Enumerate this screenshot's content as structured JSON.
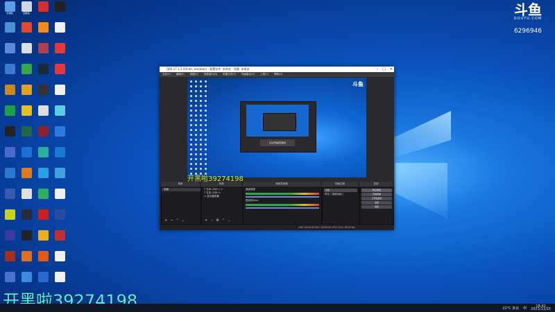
{
  "overlay_text": "开黑啦39274198",
  "preview_overlay_text": "开黑啦39274198",
  "logo": {
    "mark": "斗鱼",
    "sub": "DOUYU.COM",
    "room_number": "6296946"
  },
  "desktop_icons": [
    {
      "label": "此电脑",
      "color": "#5aa0e8"
    },
    {
      "label": "回收站",
      "color": "#cfd7e0"
    },
    {
      "label": "",
      "color": "#d23030"
    },
    {
      "label": "",
      "color": "#222"
    },
    {
      "label": "",
      "color": "#4a90d9"
    },
    {
      "label": "",
      "color": "#e04a2a"
    },
    {
      "label": "",
      "color": "#f28a1c"
    },
    {
      "label": "",
      "color": "#f0f0f0"
    },
    {
      "label": "",
      "color": "#5a8bd8"
    },
    {
      "label": "",
      "color": "#ddd"
    },
    {
      "label": "",
      "color": "#b04050"
    },
    {
      "label": "",
      "color": "#e23a3a"
    },
    {
      "label": "",
      "color": "#3a7ad0"
    },
    {
      "label": "",
      "color": "#35a84a"
    },
    {
      "label": "",
      "color": "#1b2838"
    },
    {
      "label": "",
      "color": "#e03a3a"
    },
    {
      "label": "",
      "color": "#c88a20"
    },
    {
      "label": "",
      "color": "#e6a020"
    },
    {
      "label": "",
      "color": "#333"
    },
    {
      "label": "",
      "color": "#f0f0f0"
    },
    {
      "label": "",
      "color": "#1ea04a"
    },
    {
      "label": "",
      "color": "#e8c020"
    },
    {
      "label": "",
      "color": "#ddd"
    },
    {
      "label": "",
      "color": "#5ad0e0"
    },
    {
      "label": "",
      "color": "#222"
    },
    {
      "label": "",
      "color": "#226644"
    },
    {
      "label": "",
      "color": "#8a2030"
    },
    {
      "label": "",
      "color": "#2a7ae0"
    },
    {
      "label": "",
      "color": "#4a6ad0"
    },
    {
      "label": "",
      "color": "#1a6fd8"
    },
    {
      "label": "",
      "color": "#2ab0a0"
    },
    {
      "label": "",
      "color": "#1a7ad0"
    },
    {
      "label": "",
      "color": "#2a7ad0"
    },
    {
      "label": "",
      "color": "#e07a20"
    },
    {
      "label": "",
      "color": "#2aa0e0"
    },
    {
      "label": "",
      "color": "#40a0e0"
    },
    {
      "label": "",
      "color": "#3a5ab0"
    },
    {
      "label": "",
      "color": "#e0e0e0"
    },
    {
      "label": "",
      "color": "#2ab060"
    },
    {
      "label": "",
      "color": "#f0f0f0"
    },
    {
      "label": "",
      "color": "#c8d020"
    },
    {
      "label": "",
      "color": "#2a2a3a"
    },
    {
      "label": "",
      "color": "#cc2020"
    },
    {
      "label": "",
      "color": "#2a4aa0"
    },
    {
      "label": "",
      "color": "#3a3aa0"
    },
    {
      "label": "",
      "color": "#222"
    },
    {
      "label": "",
      "color": "#e8b020"
    },
    {
      "label": "",
      "color": "#c03030"
    },
    {
      "label": "",
      "color": "#a03020"
    },
    {
      "label": "",
      "color": "#e07020"
    },
    {
      "label": "",
      "color": "#e05a1a"
    },
    {
      "label": "",
      "color": "#f0f0f0"
    },
    {
      "label": "",
      "color": "#4a70d0"
    },
    {
      "label": "",
      "color": "#3a8ae0"
    },
    {
      "label": "",
      "color": "#2a6ad0"
    },
    {
      "label": "",
      "color": "#f0f0f0"
    }
  ],
  "obs": {
    "title": "OBS 27.1.3 (64-bit, windows) - 配置文件: 未命名 - 场景: 未命名",
    "menu": [
      "文件(F)",
      "编辑(E)",
      "视图(V)",
      "停靠窗口(D)",
      "配置文件(P)",
      "场景集合(S)",
      "工具(T)",
      "帮助(H)",
      "",
      ""
    ],
    "dock_titles": {
      "scenes": "场景",
      "sources": "来源",
      "mixer": "音频混音器",
      "transitions": "场景过渡",
      "controls": "控制"
    },
    "scenes": [
      "场景"
    ],
    "sources": [
      "文本 (GDI+) 2",
      "文本 (GDI+)",
      "显示器采集"
    ],
    "mixer": [
      {
        "name": "桌面音频",
        "level": "0.0 dB"
      },
      {
        "name": "麦克风/Aux",
        "level": "0.0 dB"
      }
    ],
    "transition": {
      "type": "淡出",
      "duration_label": "时长",
      "duration": "300 ms"
    },
    "controls": [
      "停止推流",
      "开始录制",
      "工作室模式",
      "设置",
      "退出"
    ],
    "status": "LIVE: 00:00:00   REC: 00:00:00   CPU: 0.4%, 60.00 fps",
    "nested_caption": "正在开始配置推流"
  },
  "tray": {
    "weather": "22°C 多云",
    "lang": "中",
    "time": "18:41",
    "date": "2021/11/15"
  }
}
